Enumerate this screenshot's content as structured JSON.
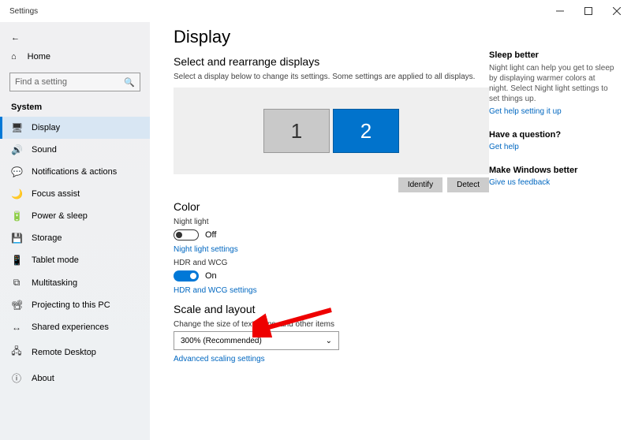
{
  "window": {
    "title": "Settings"
  },
  "sidebar": {
    "home": "Home",
    "search_placeholder": "Find a setting",
    "category": "System",
    "items": [
      {
        "icon": "🖥",
        "label": "Display"
      },
      {
        "icon": "🔊",
        "label": "Sound"
      },
      {
        "icon": "💬",
        "label": "Notifications & actions"
      },
      {
        "icon": "🌙",
        "label": "Focus assist"
      },
      {
        "icon": "🔋",
        "label": "Power & sleep"
      },
      {
        "icon": "💾",
        "label": "Storage"
      },
      {
        "icon": "📱",
        "label": "Tablet mode"
      },
      {
        "icon": "⧉",
        "label": "Multitasking"
      },
      {
        "icon": "📽",
        "label": "Projecting to this PC"
      },
      {
        "icon": "↔",
        "label": "Shared experiences"
      },
      {
        "icon": "🖧",
        "label": "Remote Desktop"
      },
      {
        "icon": "ⓘ",
        "label": "About"
      }
    ]
  },
  "main": {
    "title": "Display",
    "arrange_h": "Select and rearrange displays",
    "arrange_desc": "Select a display below to change its settings. Some settings are applied to all displays.",
    "mon1": "1",
    "mon2": "2",
    "identify": "Identify",
    "detect": "Detect",
    "color_h": "Color",
    "nightlight_label": "Night light",
    "nightlight_state": "Off",
    "nightlight_link": "Night light settings",
    "hdr_label": "HDR and WCG",
    "hdr_state": "On",
    "hdr_link": "HDR and WCG settings",
    "scale_h": "Scale and layout",
    "scale_label": "Change the size of text, apps, and other items",
    "scale_value": "300% (Recommended)",
    "advanced_link": "Advanced scaling settings"
  },
  "aside": {
    "sleep_h": "Sleep better",
    "sleep_p": "Night light can help you get to sleep by displaying warmer colors at night. Select Night light settings to set things up.",
    "sleep_link": "Get help setting it up",
    "q_h": "Have a question?",
    "q_link": "Get help",
    "fb_h": "Make Windows better",
    "fb_link": "Give us feedback"
  }
}
